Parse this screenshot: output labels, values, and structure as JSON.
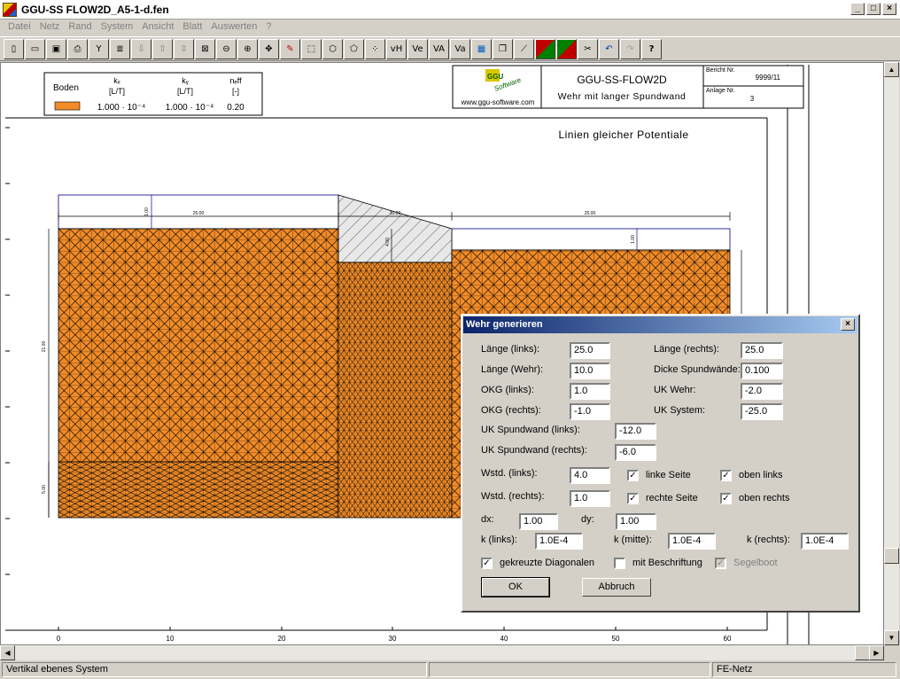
{
  "window": {
    "title": "GGU-SS FLOW2D_A5-1-d.fen",
    "min": "_",
    "max": "□",
    "close": "×"
  },
  "menu": [
    "Datei",
    "Netz",
    "Rand",
    "System",
    "Ansicht",
    "Blatt",
    "Auswerten",
    "?"
  ],
  "toolbar": {
    "buttons": [
      "file-new-icon",
      "open-folder-icon",
      "save-icon",
      "print-icon",
      "tool-icon",
      "list-icon",
      "arrow-down-icon",
      "arrow-up-icon",
      "arrow-updown-icon",
      "zoom-box-icon",
      "zoom-out-icon",
      "zoom-in-icon",
      "pan-icon",
      "edit-icon",
      "grid-icon",
      "hex-icon",
      "node-icon",
      "dots-icon",
      "vH",
      "Ve",
      "VA",
      "Va",
      "table-icon",
      "copy-icon",
      "line-icon",
      "color-icon",
      "color2-icon",
      "cut-icon",
      "undo-icon",
      "redo-icon",
      "?"
    ],
    "text_buttons": {
      "vh": "vH",
      "ve": "Ve",
      "va": "VA",
      "va2": "Va",
      "help": "?"
    }
  },
  "legend": {
    "boden_label": "Boden",
    "kx_header": "kₓ",
    "kx_unit": "[L/T]",
    "ky_header": "kᵧ",
    "ky_unit": "[L/T]",
    "neff_header": "nₑff",
    "neff_unit": "[-]",
    "kx_value": "1.000 · 10⁻⁴",
    "ky_value": "1.000 · 10⁻⁴",
    "neff_value": "0.20",
    "soil_color": "#f28c28"
  },
  "titleblock": {
    "logo_top": "GGU",
    "logo_sub": "Software",
    "url": "www.ggu-software.com",
    "program": "GGU-SS-FLOW2D",
    "subtitle": "Wehr mit langer Spundwand",
    "bericht_label": "Bericht Nr.",
    "bericht_value": "9999/11",
    "anlage_label": "Anlage Nr.",
    "anlage_value": "3"
  },
  "drawing": {
    "heading": "Linien gleicher Potentiale",
    "dim_left": "25.00",
    "dim_mid": "10.00",
    "dim_right": "25.00",
    "dim_top_left": "1.00",
    "dim_weir": "4.00",
    "dim_top_right": "1.00",
    "dim_height": "21.00",
    "dim_bottom": "5.00",
    "x_ticks": [
      "0",
      "10",
      "20",
      "30",
      "40",
      "50",
      "60"
    ]
  },
  "dialog": {
    "title": "Wehr generieren",
    "close": "×",
    "laenge_links_label": "Länge (links):",
    "laenge_links": "25.0",
    "laenge_rechts_label": "Länge (rechts):",
    "laenge_rechts": "25.0",
    "laenge_wehr_label": "Länge (Wehr):",
    "laenge_wehr": "10.0",
    "dicke_label": "Dicke Spundwände:",
    "dicke": "0.100",
    "okg_links_label": "OKG (links):",
    "okg_links": "1.0",
    "uk_wehr_label": "UK Wehr:",
    "uk_wehr": "-2.0",
    "okg_rechts_label": "OKG (rechts):",
    "okg_rechts": "-1.0",
    "uk_system_label": "UK System:",
    "uk_system": "-25.0",
    "uk_sp_links_label": "UK Spundwand (links):",
    "uk_sp_links": "-12.0",
    "uk_sp_rechts_label": "UK Spundwand (rechts):",
    "uk_sp_rechts": "-6.0",
    "wstd_links_label": "Wstd. (links):",
    "wstd_links": "4.0",
    "linke_seite": "linke Seite",
    "oben_links": "oben links",
    "wstd_rechts_label": "Wstd. (rechts):",
    "wstd_rechts": "1.0",
    "rechte_seite": "rechte Seite",
    "oben_rechts": "oben rechts",
    "dx_label": "dx:",
    "dx": "1.00",
    "dy_label": "dy:",
    "dy": "1.00",
    "k_links_label": "k (links):",
    "k_links": "1.0E-4",
    "k_mitte_label": "k (mitte):",
    "k_mitte": "1.0E-4",
    "k_rechts_label": "k (rechts):",
    "k_rechts": "1.0E-4",
    "gekreuzte": "gekreuzte Diagonalen",
    "beschriftung": "mit Beschriftung",
    "segelboot": "Segelboot",
    "check": "✓",
    "ok": "OK",
    "abbruch": "Abbruch"
  },
  "statusbar": {
    "left": "Vertikal ebenes System",
    "middle": "",
    "right": "FE-Netz"
  }
}
